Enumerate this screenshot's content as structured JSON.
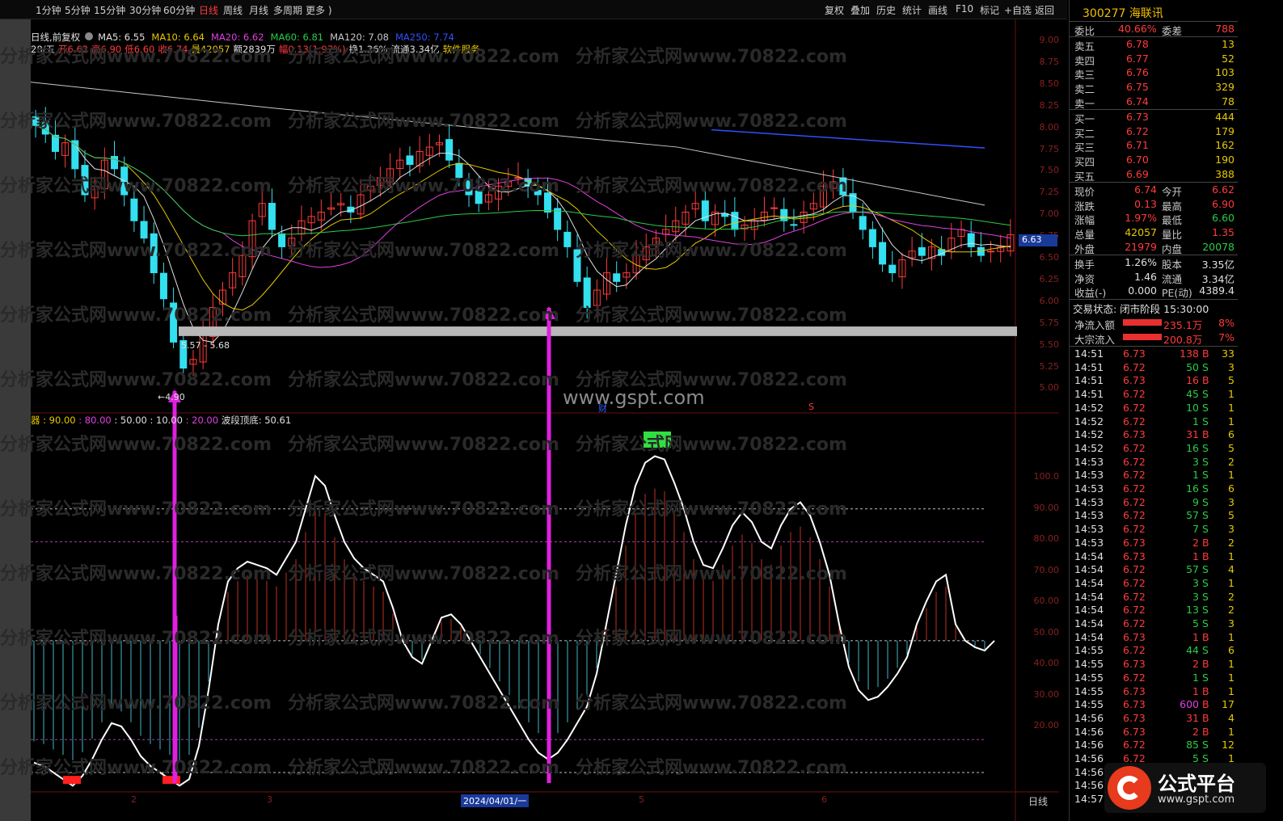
{
  "toolbar": {
    "periods": [
      "1分钟",
      "5分钟",
      "15分钟",
      "30分钟",
      "60分钟",
      "日线",
      "周线",
      "月线",
      "多周期",
      "更多 )"
    ],
    "active_period": "日线",
    "right_tools": [
      "复权",
      "叠加",
      "历史",
      "统计",
      "画线",
      "F10",
      "标记",
      "+自选",
      "返回"
    ]
  },
  "chart_header": {
    "label": "日线,前复权",
    "ma": [
      {
        "text": "MA5: 6.55",
        "color": "#e0e0e0"
      },
      {
        "text": "MA10: 6.64",
        "color": "#e8c800"
      },
      {
        "text": "MA20: 6.62",
        "color": "#e040e0"
      },
      {
        "text": "MA60: 6.81",
        "color": "#2ccb47"
      },
      {
        "text": "MA120: 7.08",
        "color": "#c8c8c8"
      },
      {
        "text": "MA250: 7.74",
        "color": "#3050ff"
      }
    ],
    "ohlc": [
      {
        "text": "28/五",
        "color": "#e0e0e0"
      },
      {
        "text": "开6.62",
        "color": "#ff3b3b"
      },
      {
        "text": "高6.90",
        "color": "#ff3b3b"
      },
      {
        "text": "低6.60",
        "color": "#ff3b3b"
      },
      {
        "text": "收6.74",
        "color": "#ff3b3b"
      },
      {
        "text": "量42057",
        "color": "#e8c800"
      },
      {
        "text": "额2839万",
        "color": "#e0e0e0"
      },
      {
        "text": "幅0.13(1.97%)",
        "color": "#ff3b3b"
      },
      {
        "text": "换1.26%",
        "color": "#e0e0e0"
      },
      {
        "text": "流通3.34亿",
        "color": "#e0e0e0"
      },
      {
        "text": "软件服务",
        "color": "#e8c800"
      }
    ]
  },
  "price_axis": [
    "9.00",
    "8.75",
    "8.50",
    "8.25",
    "8.00",
    "7.75",
    "7.50",
    "7.25",
    "7.00",
    "6.75",
    "6.50",
    "6.25",
    "6.00",
    "5.75",
    "5.50",
    "5.25",
    "5.00"
  ],
  "current_price_tag": "6.63",
  "support_zone_label": "5.57 - 5.68",
  "low_marker": "←4.90",
  "watermark_center": "www.gspt.com",
  "watermark_repeat": "分析家公式网www.70822.com",
  "chart_markers": {
    "cai": "财",
    "s": "S"
  },
  "indicator_header": {
    "parts": [
      {
        "text": "器 : 90.00",
        "color": "#e8c800"
      },
      {
        "text": " : 80.00",
        "color": "#e040e0"
      },
      {
        "text": " : 50.00 : 10.00",
        "color": "#e0e0e0"
      },
      {
        "text": " : 20.00",
        "color": "#e040e0"
      },
      {
        "text": "  波段顶底: 50.61",
        "color": "#e0e0e0"
      }
    ]
  },
  "osc_axis": [
    "100.0",
    "90.00",
    "80.00",
    "70.00",
    "60.00",
    "50.00",
    "40.00",
    "30.00",
    "20.00"
  ],
  "date_axis": {
    "labels": [
      "2",
      "3",
      "2024/04/01/一",
      "5",
      "6"
    ],
    "period": "日线"
  },
  "chart_data": {
    "type": "candlestick",
    "indicators": [
      "MA5",
      "MA10",
      "MA20",
      "MA60",
      "MA120",
      "MA250",
      "波段顶底"
    ],
    "support_zone": [
      5.57,
      5.68
    ],
    "low": 4.9,
    "last_close": 6.63
  },
  "quote": {
    "title": "300277 海联讯",
    "webi": "委比",
    "webi_val": "40.66%",
    "weicha": "委差",
    "weicha_val": "788",
    "sells": [
      {
        "label": "卖五",
        "price": "6.78",
        "vol": "13"
      },
      {
        "label": "卖四",
        "price": "6.77",
        "vol": "52"
      },
      {
        "label": "卖三",
        "price": "6.76",
        "vol": "103"
      },
      {
        "label": "卖二",
        "price": "6.75",
        "vol": "329"
      },
      {
        "label": "卖一",
        "price": "6.74",
        "vol": "78"
      }
    ],
    "buys": [
      {
        "label": "买一",
        "price": "6.73",
        "vol": "444"
      },
      {
        "label": "买二",
        "price": "6.72",
        "vol": "179"
      },
      {
        "label": "买三",
        "price": "6.71",
        "vol": "162"
      },
      {
        "label": "买四",
        "price": "6.70",
        "vol": "190"
      },
      {
        "label": "买五",
        "price": "6.69",
        "vol": "388"
      }
    ],
    "stats": [
      {
        "l1": "现价",
        "v1": "6.74",
        "c1": "red",
        "l2": "今开",
        "v2": "6.62",
        "c2": "red"
      },
      {
        "l1": "涨跌",
        "v1": "0.13",
        "c1": "red",
        "l2": "最高",
        "v2": "6.90",
        "c2": "red"
      },
      {
        "l1": "涨幅",
        "v1": "1.97%",
        "c1": "red",
        "l2": "最低",
        "v2": "6.60",
        "c2": "green"
      },
      {
        "l1": "总量",
        "v1": "42057",
        "c1": "yellow",
        "l2": "量比",
        "v2": "1.35",
        "c2": "red"
      },
      {
        "l1": "外盘",
        "v1": "21979",
        "c1": "red",
        "l2": "内盘",
        "v2": "20078",
        "c2": "green"
      }
    ],
    "stats2": [
      {
        "l1": "换手",
        "v1": "1.26%",
        "l2": "股本",
        "v2": "3.35亿"
      },
      {
        "l1": "净资",
        "v1": "1.46",
        "l2": "流通",
        "v2": "3.34亿"
      },
      {
        "l1": "收益(-)",
        "v1": "0.000",
        "l2": "PE(动)",
        "v2": "4389.4"
      }
    ],
    "trade_status": "交易状态: 闭市阶段 15:30:00",
    "flows": [
      {
        "label": "净流入额",
        "value": "235.1万",
        "pct": "8%"
      },
      {
        "label": "大宗流入",
        "value": "200.8万",
        "pct": "7%"
      }
    ],
    "ticks": [
      [
        "14:51",
        "6.73",
        "138",
        "B",
        "33"
      ],
      [
        "14:51",
        "6.72",
        "50",
        "S",
        "3"
      ],
      [
        "14:51",
        "6.73",
        "16",
        "B",
        "5"
      ],
      [
        "14:51",
        "6.72",
        "45",
        "S",
        "1"
      ],
      [
        "14:52",
        "6.72",
        "10",
        "S",
        "1"
      ],
      [
        "14:52",
        "6.72",
        "1",
        "S",
        "1"
      ],
      [
        "14:52",
        "6.73",
        "31",
        "B",
        "6"
      ],
      [
        "14:52",
        "6.72",
        "16",
        "S",
        "5"
      ],
      [
        "14:53",
        "6.72",
        "3",
        "S",
        "2"
      ],
      [
        "14:53",
        "6.72",
        "1",
        "S",
        "1"
      ],
      [
        "14:53",
        "6.72",
        "16",
        "S",
        "6"
      ],
      [
        "14:53",
        "6.72",
        "9",
        "S",
        "3"
      ],
      [
        "14:53",
        "6.72",
        "57",
        "S",
        "5"
      ],
      [
        "14:53",
        "6.72",
        "7",
        "S",
        "3"
      ],
      [
        "14:53",
        "6.73",
        "2",
        "B",
        "2"
      ],
      [
        "14:54",
        "6.73",
        "1",
        "B",
        "1"
      ],
      [
        "14:54",
        "6.72",
        "57",
        "S",
        "4"
      ],
      [
        "14:54",
        "6.72",
        "3",
        "S",
        "1"
      ],
      [
        "14:54",
        "6.72",
        "3",
        "S",
        "2"
      ],
      [
        "14:54",
        "6.72",
        "13",
        "S",
        "2"
      ],
      [
        "14:54",
        "6.72",
        "5",
        "S",
        "3"
      ],
      [
        "14:54",
        "6.73",
        "1",
        "B",
        "1"
      ],
      [
        "14:55",
        "6.72",
        "44",
        "S",
        "6"
      ],
      [
        "14:55",
        "6.73",
        "2",
        "B",
        "1"
      ],
      [
        "14:55",
        "6.72",
        "1",
        "S",
        "1"
      ],
      [
        "14:55",
        "6.73",
        "1",
        "B",
        "1"
      ],
      [
        "14:55",
        "6.73",
        "600",
        "B",
        "17"
      ],
      [
        "14:56",
        "6.73",
        "31",
        "B",
        "4"
      ],
      [
        "14:56",
        "6.73",
        "2",
        "B",
        "1"
      ],
      [
        "14:56",
        "6.72",
        "85",
        "S",
        "12"
      ],
      [
        "14:56",
        "6.72",
        "5",
        "S",
        "1"
      ],
      [
        "14:56",
        "",
        ""
      ],
      [
        "14:56",
        "",
        ""
      ],
      [
        "14:57",
        "",
        ""
      ]
    ]
  },
  "logo": {
    "text": "公式平台",
    "url": "www.gspt.com"
  }
}
